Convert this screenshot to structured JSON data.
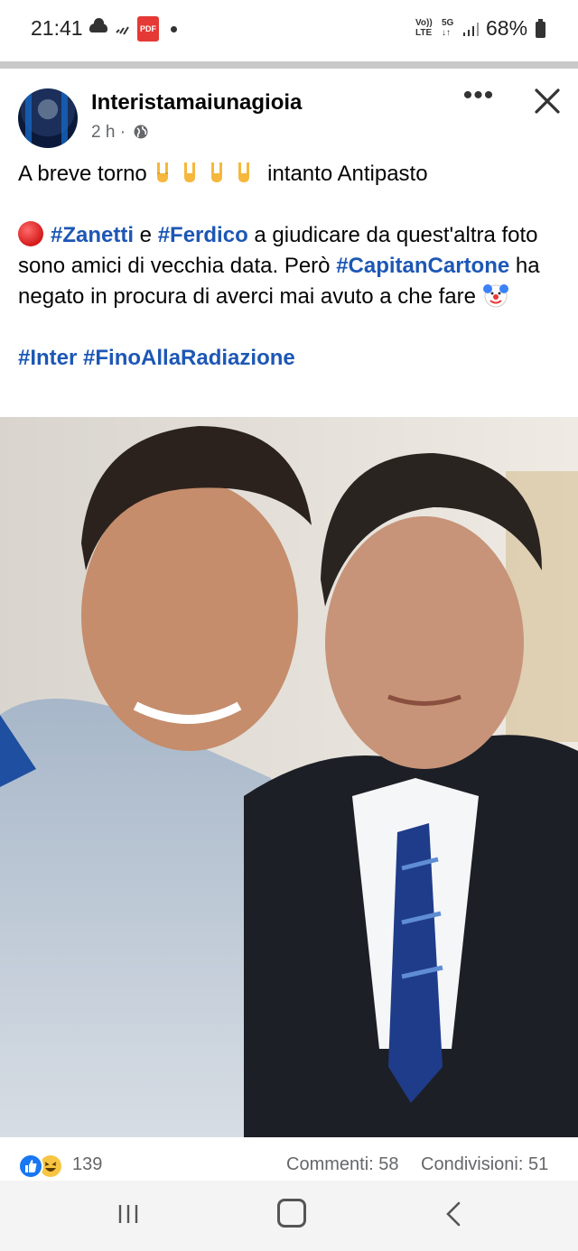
{
  "status_bar": {
    "time": "21:41",
    "pdf_label": "PDF",
    "volte_top": "Vo))",
    "volte_bottom": "LTE",
    "network_top": "5G",
    "network_bottom": "↓↑",
    "battery": "68%",
    "icons": [
      "cloud-icon",
      "signal-icon",
      "pdf-icon",
      "dot-icon",
      "volte-icon",
      "5g-icon",
      "signal-bars-icon",
      "battery-icon"
    ]
  },
  "post": {
    "author": "Interistamaiunagioia",
    "time": "2 h",
    "time_sep": " · ",
    "line1_before": "A breve torno ",
    "line1_after": " intanto Antipasto",
    "hash_zanetti": "#Zanetti",
    "and": " e ",
    "hash_ferdico": "#Ferdico",
    "para2_a": " a giudicare da quest'altra foto sono amici di vecchia data. Però ",
    "hash_capitan": "#CapitanCartone",
    "para2_b": " ha negato in procura di averci mai avuto a che fare ",
    "hash_inter": "#Inter",
    "space": " ",
    "hash_fino": "#FinoAllaRadiazione"
  },
  "footer": {
    "reactions_count": "139",
    "comments": "Commenti: 58",
    "shares": "Condivisioni: 51"
  },
  "colors": {
    "hashtag": "#1d57b5",
    "secondary_text": "#65676b",
    "like_blue": "#1877f2"
  }
}
